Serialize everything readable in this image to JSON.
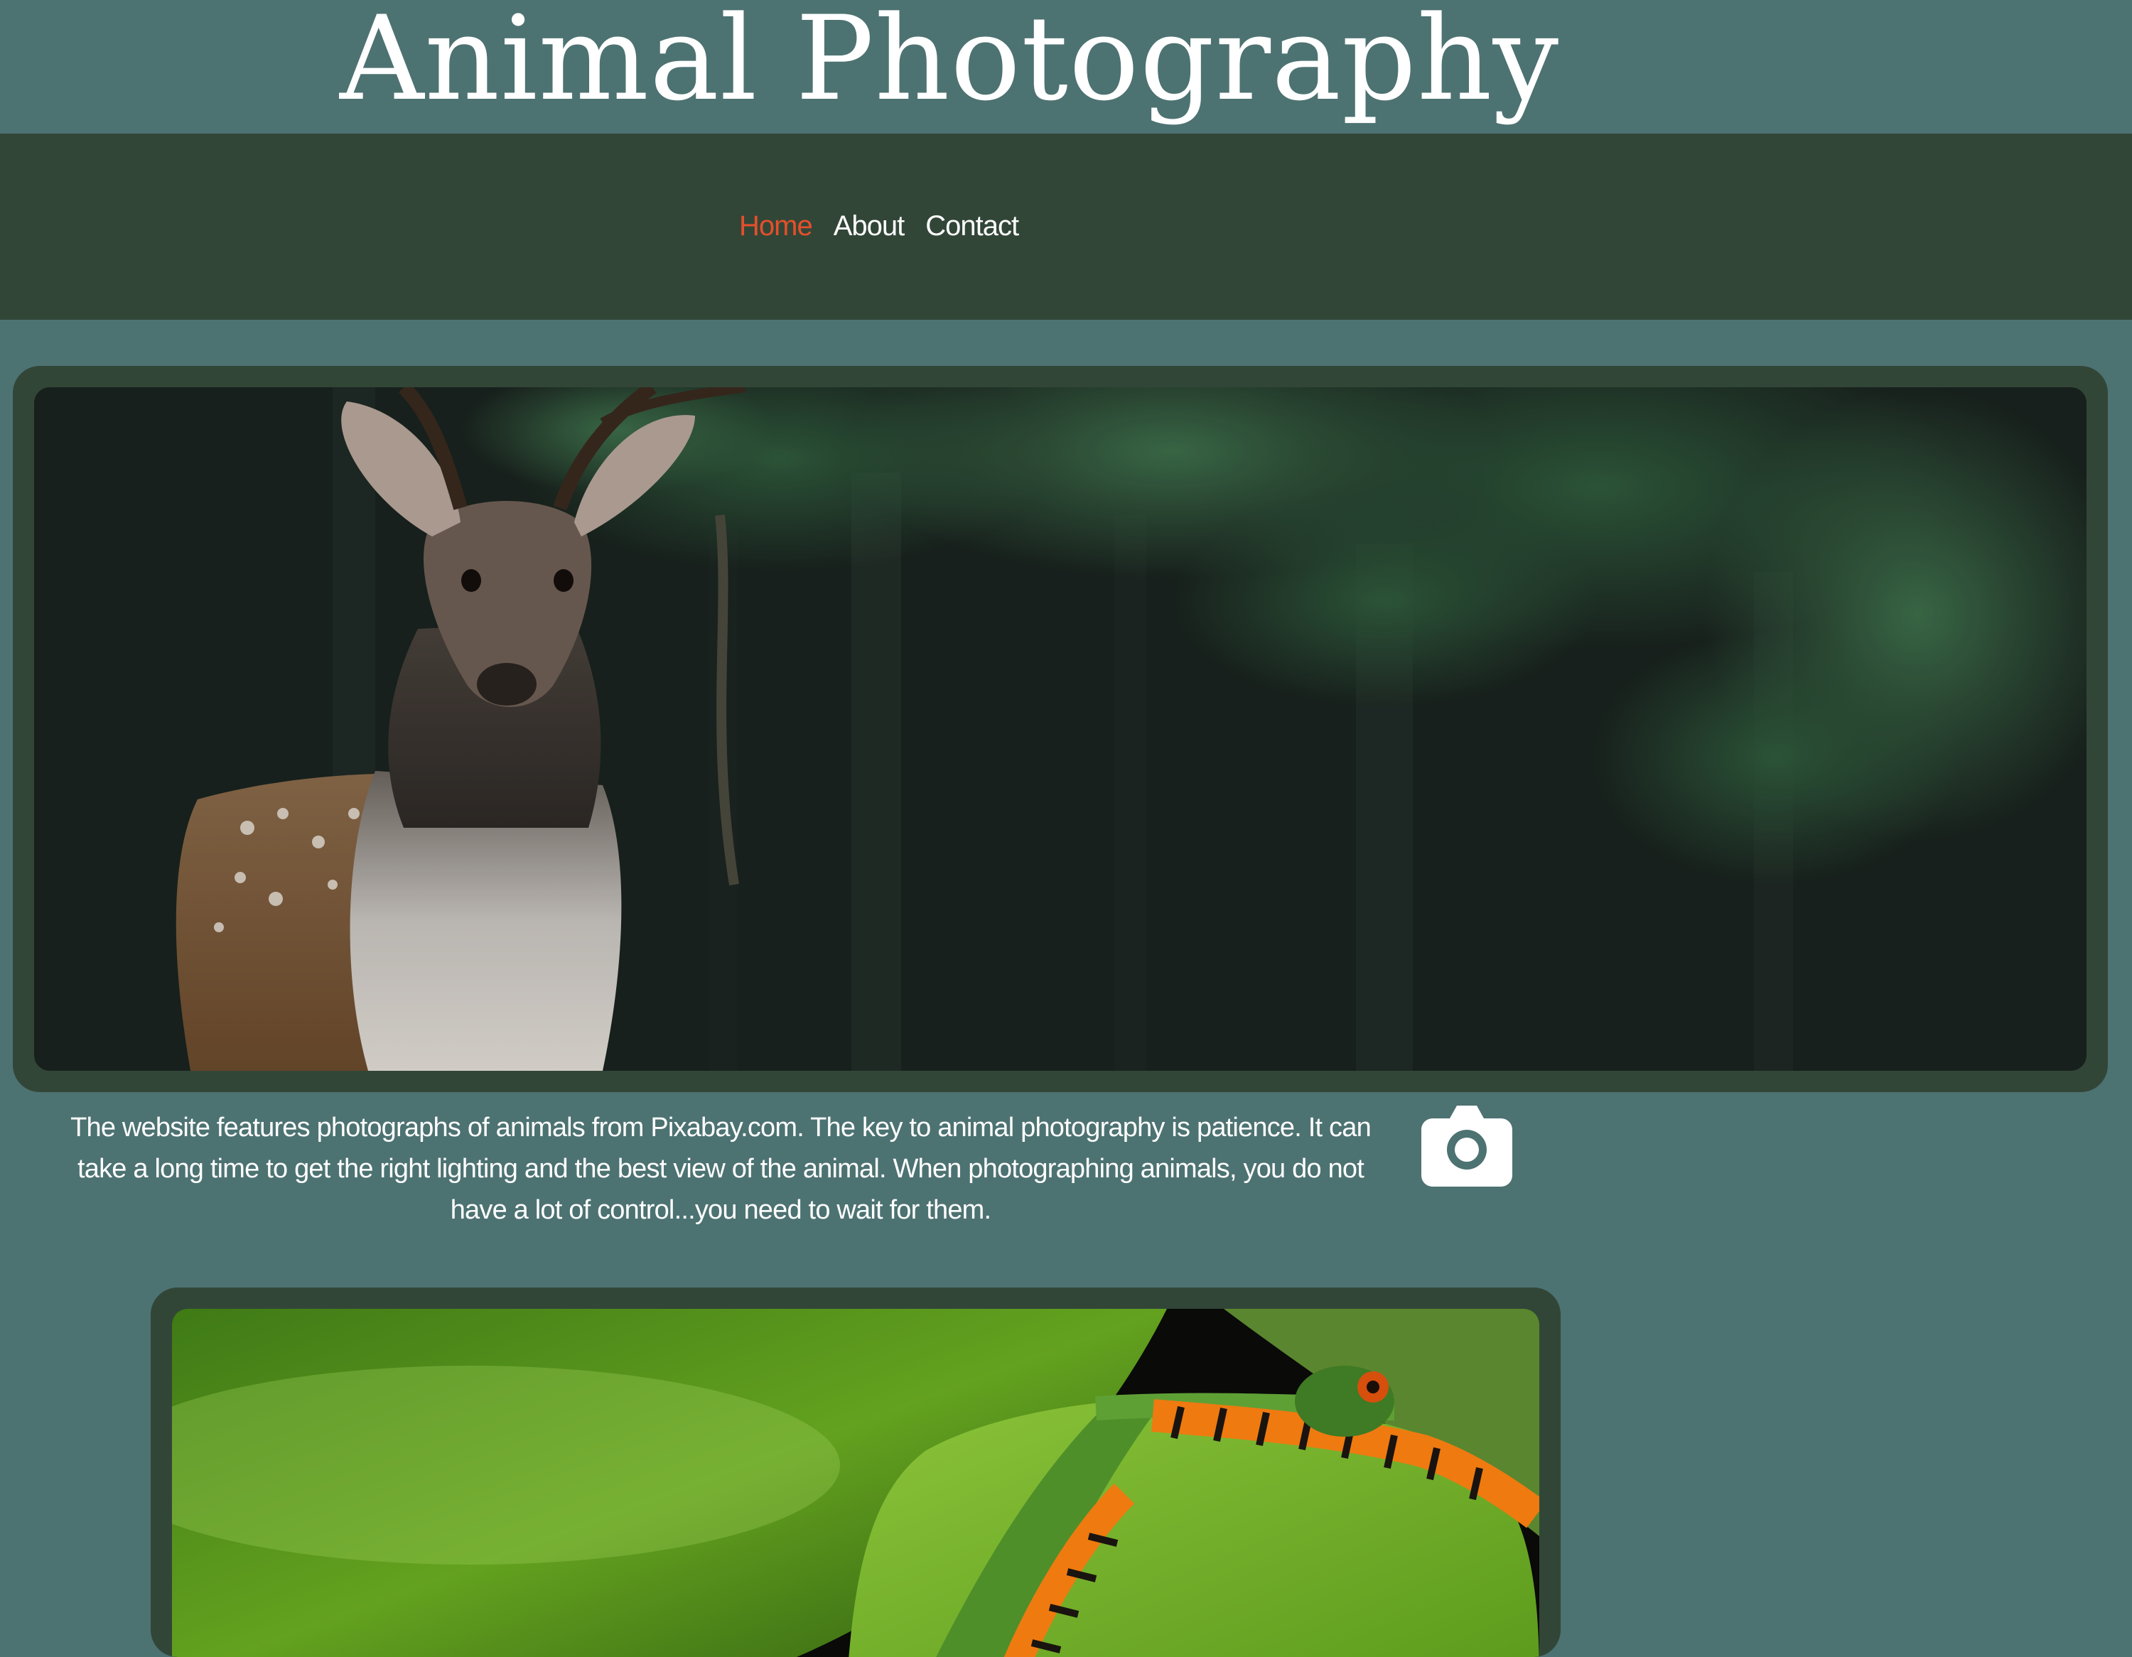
{
  "header": {
    "title": "Animal Photography"
  },
  "nav": {
    "items": [
      {
        "label": "Home",
        "active": true
      },
      {
        "label": "About",
        "active": false
      },
      {
        "label": "Contact",
        "active": false
      }
    ]
  },
  "main": {
    "hero_image": {
      "subject": "deer"
    },
    "intro_text": "The website features photographs of animals from Pixabay.com. The key to animal photography is patience. It can take a long time to get the right lighting and the best view of the animal. When photographing animals, you do not have a lot of control...you need to wait for them.",
    "intro_icon": "camera-icon",
    "second_image": {
      "subject": "frog"
    }
  },
  "colors": {
    "page_background": "#4d7272",
    "nav_background": "#324638",
    "frame_background": "#324638",
    "active_link": "#e4502b",
    "text": "#ffffff"
  }
}
